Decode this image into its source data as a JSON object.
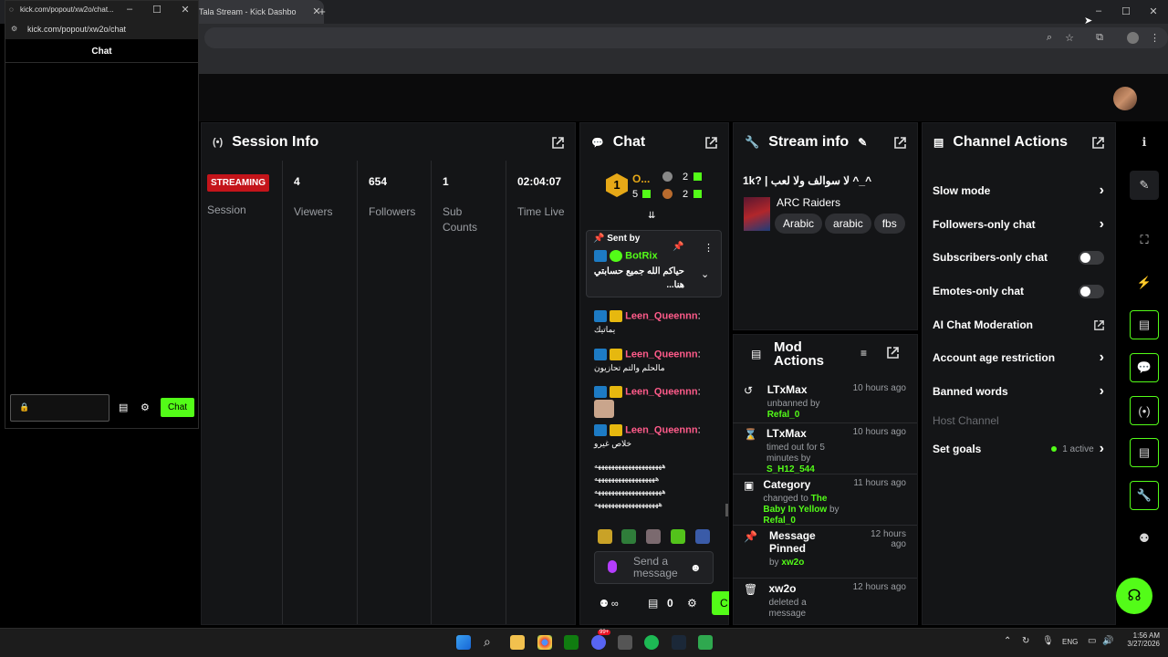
{
  "browser": {
    "tab_title": "oTala Stream - Kick Dashbo",
    "new_tab": "+",
    "window_controls": [
      "–",
      "☐",
      "✕"
    ]
  },
  "popout": {
    "title": "kick.com/popout/xw2o/chat...",
    "url": "kick.com/popout/xw2o/chat",
    "header": "Chat",
    "chat_button": "Chat",
    "window_controls": [
      "–",
      "☐",
      "✕"
    ]
  },
  "session": {
    "title": "Session Info",
    "status_badge": "STREAMING",
    "status_label": "Session",
    "stats": [
      {
        "value": "4",
        "label": "Viewers"
      },
      {
        "value": "654",
        "label": "Followers"
      },
      {
        "value": "1",
        "label": "Sub Counts"
      },
      {
        "value": "02:04:07",
        "label": "Time Live"
      }
    ]
  },
  "chat": {
    "title": "Chat",
    "top_user": "O...",
    "top_rank": "1",
    "count_a": "2",
    "count_b": "2",
    "count_c": "5",
    "count_d": "2",
    "pinned_header": "Sent by",
    "pinned_user": "BotRix",
    "pinned_text": "حياكم الله جميع حسابتي هنا...",
    "messages": [
      {
        "user": "Leen_Queennn",
        "sep": ":",
        "text": "يماتيك"
      },
      {
        "user": "Leen_Queennn",
        "sep": ":",
        "text": "مالحلم والتم تحازيون"
      },
      {
        "user": "Leen_Queennn",
        "sep": ":",
        "text": ""
      },
      {
        "user": "Leen_Queennn",
        "sep": ":",
        "text": "خلاص غيرو"
      }
    ],
    "spam_lines": [
      "ههههههههههههههههههههه",
      "ههههههههههههههههههه",
      "ههههههههههههههههههههه",
      "هههههههههههههههههههه"
    ],
    "input_placeholder": "Send a message",
    "points": "0",
    "send_short": "C"
  },
  "stream_info": {
    "title": "Stream info",
    "stream_title": "1k? | لا سوالف ولا لعب ^_^",
    "category": "ARC Raiders",
    "tags": [
      "Arabic",
      "arabic",
      "fbs"
    ]
  },
  "mod_actions": {
    "title": "Mod Actions",
    "items": [
      {
        "icon": "unban-icon",
        "name": "LTxMax",
        "line1": "unbanned by ",
        "actor": "Refal_0",
        "time": "10 hours ago"
      },
      {
        "icon": "hourglass-icon",
        "name": "LTxMax",
        "line1": "timed out for 5 minutes by ",
        "actor": "S_H12_544",
        "time": "10 hours ago"
      },
      {
        "icon": "category-icon",
        "name": "Category",
        "line1": "changed to ",
        "target": "The Baby In Yellow",
        "line2": " by ",
        "actor": "Refal_0",
        "time": "11 hours ago"
      },
      {
        "icon": "pin-icon",
        "name": "Message Pinned",
        "line1": "by ",
        "actor": "xw2o",
        "time": "12 hours ago"
      },
      {
        "icon": "trash-icon",
        "name": "xw2o",
        "line1": "deleted a message",
        "time": "12 hours ago"
      }
    ]
  },
  "channel_actions": {
    "title": "Channel Actions",
    "items": [
      {
        "label": "Slow mode",
        "control": "chevron"
      },
      {
        "label": "Followers-only chat",
        "control": "chevron"
      },
      {
        "label": "Subscribers-only chat",
        "control": "toggle"
      },
      {
        "label": "Emotes-only chat",
        "control": "toggle"
      },
      {
        "label": "AI Chat Moderation",
        "control": "external"
      },
      {
        "label": "Account age restriction",
        "control": "chevron"
      },
      {
        "label": "Banned words",
        "control": "chevron"
      },
      {
        "label": "Host Channel",
        "control": "none"
      },
      {
        "label": "Set goals",
        "control": "chevron",
        "status": "1 active"
      }
    ]
  },
  "taskbar": {
    "lang": "ENG",
    "time": "1:56 AM",
    "date": "3/27/2026",
    "badge": "99+"
  },
  "colors": {
    "accent": "#53fc18",
    "streaming": "#c4141a",
    "username": "#ff5b8a"
  }
}
